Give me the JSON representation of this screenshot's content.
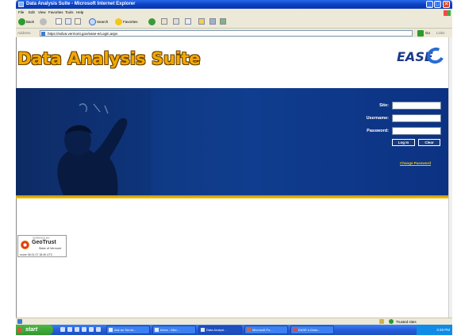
{
  "window": {
    "title": "Data Analysis Suite - Microsoft Internet Explorer",
    "min_label": "_",
    "max_label": "□",
    "close_label": "✕"
  },
  "menu": [
    "File",
    "Edit",
    "View",
    "Favorites",
    "Tools",
    "Help"
  ],
  "toolbar": {
    "back_label": "Back",
    "search_label": "Search",
    "favorites_label": "Favorites"
  },
  "address": {
    "label": "Address",
    "url": "https://ediva.vermont.gov/ease-e/Login.aspx",
    "go_label": "Go",
    "links_label": "Links"
  },
  "page": {
    "brand_title": "Data Analysis Suite",
    "brand_logo_text": "EASE",
    "form": {
      "site_label": "Site:",
      "username_label": "Username:",
      "password_label": "Password:",
      "login_label": "Log In",
      "clear_label": "Clear",
      "change_password": "Change Password"
    },
    "seal": {
      "verified_by": "VERIFIED BY",
      "brand": "GeoTrust",
      "org": "State of Vermont",
      "timestamp": "ncore 06.01.07 18:40 UTC"
    }
  },
  "status": {
    "zone": "Trusted sites"
  },
  "taskbar": {
    "start_label": "start",
    "tasks": [
      "Ask an Servic...",
      "Inbox - Micr...",
      "Data Analysi...",
      "Microsoft Po...",
      "EASE e-Data..."
    ],
    "clock": "3:48 PM"
  }
}
